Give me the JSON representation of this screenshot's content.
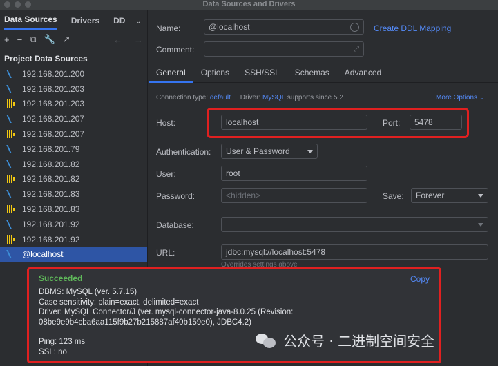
{
  "window": {
    "title": "Data Sources and Drivers"
  },
  "left": {
    "tabs": [
      "Data Sources",
      "Drivers",
      "DD"
    ],
    "more_tabs": "⌄",
    "toolbar": [
      "+",
      "−",
      "⧉",
      "🔧",
      "↗"
    ],
    "section_title": "Project Data Sources",
    "items": [
      {
        "label": "192.168.201.200",
        "icon": "mysql-icon"
      },
      {
        "label": "192.168.201.203",
        "icon": "mysql-icon"
      },
      {
        "label": "192.168.201.203",
        "icon": "clickhouse-icon"
      },
      {
        "label": "192.168.201.207",
        "icon": "mysql-icon"
      },
      {
        "label": "192.168.201.207",
        "icon": "clickhouse-icon"
      },
      {
        "label": "192.168.201.79",
        "icon": "mysql-icon"
      },
      {
        "label": "192.168.201.82",
        "icon": "mysql-icon"
      },
      {
        "label": "192.168.201.82",
        "icon": "clickhouse-icon"
      },
      {
        "label": "192.168.201.83",
        "icon": "mysql-icon"
      },
      {
        "label": "192.168.201.83",
        "icon": "clickhouse-icon"
      },
      {
        "label": "192.168.201.92",
        "icon": "mysql-icon"
      },
      {
        "label": "192.168.201.92",
        "icon": "clickhouse-icon"
      },
      {
        "label": "@localhost",
        "icon": "mysql-icon"
      }
    ]
  },
  "form": {
    "name_label": "Name:",
    "name_value": "@localhost",
    "create_ddl": "Create DDL Mapping",
    "comment_label": "Comment:",
    "tabs": [
      "General",
      "Options",
      "SSH/SSL",
      "Schemas",
      "Advanced"
    ],
    "conn_type_label": "Connection type:",
    "conn_type_value": "default",
    "driver_label": "Driver:",
    "driver_value": "MySQL",
    "driver_suffix": "supports since 5.2",
    "more_options": "More Options ⌄",
    "host_label": "Host:",
    "host_value": "localhost",
    "port_label": "Port:",
    "port_value": "5478",
    "auth_label": "Authentication:",
    "auth_value": "User & Password",
    "user_label": "User:",
    "user_value": "root",
    "password_label": "Password:",
    "password_placeholder": "<hidden>",
    "save_label": "Save:",
    "save_value": "Forever",
    "database_label": "Database:",
    "url_label": "URL:",
    "url_value": "jdbc:mysql://localhost:5478",
    "url_hint": "Overrides settings above"
  },
  "popup": {
    "status": "Succeeded",
    "copy": "Copy",
    "lines": [
      "DBMS: MySQL (ver. 5.7.15)",
      "Case sensitivity: plain=exact, delimited=exact",
      "Driver: MySQL Connector/J (ver. mysql-connector-java-8.0.25 (Revision:",
      "08be9e9b4cba6aa115f9b27b215887af40b159e0), JDBC4.2)",
      "",
      "Ping: 123 ms",
      "SSL: no"
    ]
  },
  "watermark": {
    "text": "公众号 · 二进制空间安全"
  },
  "colors": {
    "accent": "#3574f0",
    "link": "#548af7",
    "success": "#5fb85a",
    "highlight": "#e02020",
    "selected": "#2e55a5"
  }
}
